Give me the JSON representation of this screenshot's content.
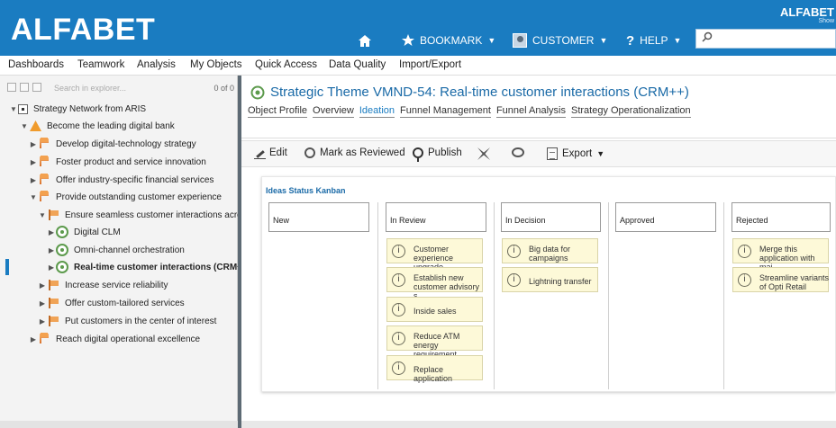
{
  "brand": {
    "logo": "ALFABET",
    "logo_small": "ALFABET",
    "logo_sub": "Show"
  },
  "topnav": {
    "bookmark": "BOOKMARK",
    "customer": "CUSTOMER",
    "help": "HELP",
    "help_mark": "?"
  },
  "menu": [
    "Dashboards",
    "Teamwork",
    "Analysis",
    "My Objects",
    "Quick Access",
    "Data Quality",
    "Import/Export"
  ],
  "explorer": {
    "search_placeholder": "Search in explorer...",
    "count": "0 of 0"
  },
  "tree": [
    {
      "label": "Strategy Network from ARIS",
      "icon": "root-icon"
    },
    {
      "label": "Become the leading digital bank",
      "icon": "warning-icon"
    },
    {
      "label": "Develop digital-technology strategy",
      "icon": "goal-icon"
    },
    {
      "label": "Foster product and service innovation",
      "icon": "goal-icon"
    },
    {
      "label": "Offer industry-specific financial services",
      "icon": "goal-icon"
    },
    {
      "label": "Provide outstanding customer experience",
      "icon": "goal-icon"
    },
    {
      "label": "Ensure seamless customer interactions across",
      "icon": "flag-icon"
    },
    {
      "label": "Digital CLM",
      "icon": "target-icon"
    },
    {
      "label": "Omni-channel orchestration",
      "icon": "target-icon"
    },
    {
      "label": "Real-time customer interactions (CRM++)",
      "icon": "target-icon"
    },
    {
      "label": "Increase service reliability",
      "icon": "flag-icon"
    },
    {
      "label": "Offer custom-tailored services",
      "icon": "flag-icon"
    },
    {
      "label": "Put customers in the center of interest",
      "icon": "flag-icon"
    },
    {
      "label": "Reach digital operational excellence",
      "icon": "goal-icon"
    }
  ],
  "page": {
    "title": "Strategic Theme VMND-54: Real-time customer interactions (CRM++)",
    "tabs": [
      "Object Profile",
      "Overview",
      "Ideation",
      "Funnel Management",
      "Funnel Analysis",
      "Strategy Operationalization"
    ],
    "active_tab": "Ideation"
  },
  "toolbar": {
    "edit": "Edit",
    "mark_reviewed": "Mark as Reviewed",
    "publish": "Publish",
    "export": "Export"
  },
  "kanban": {
    "title": "Ideas Status Kanban",
    "columns": [
      "New",
      "In Review",
      "In Decision",
      "Approved",
      "Rejected"
    ],
    "cards": {
      "in_review": [
        "Customer\nexperience upgrade",
        "Establish new\ncustomer advisory s",
        "Inside sales",
        "Reduce ATM\nenergy requirement",
        "Replace application"
      ],
      "in_decision": [
        "Big data for\ncampaigns",
        "Lightning transfer"
      ],
      "rejected": [
        "Merge this\napplication with mai",
        "Streamline variants\nof Opti Retail"
      ]
    },
    "info_mark": "i"
  }
}
